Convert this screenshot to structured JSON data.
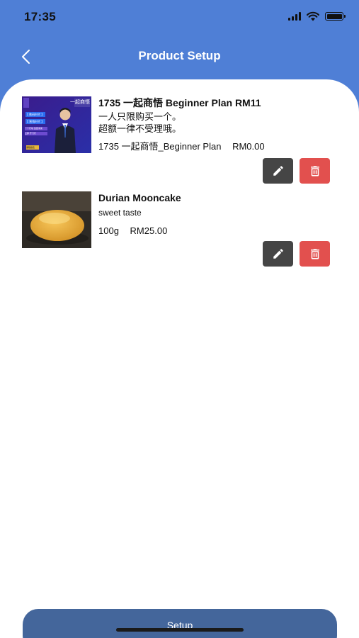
{
  "status_bar": {
    "time": "17:35"
  },
  "nav": {
    "title": "Product Setup"
  },
  "products": [
    {
      "name": "1735 一起商悟 Beginner Plan RM11",
      "description": "一人只限购买一个。\n超额一律不受理哦。",
      "variant": "1735 一起商悟_Beginner Plan",
      "price": "RM0.00",
      "thumb": {
        "brand_text": "一起商悟",
        "caption_1": "【 数码时代 】",
        "caption_2": "【 营销时代 】",
        "caption_3": "一个行动 改变未来",
        "caption_4": "立即 开门行",
        "tag": "课程报名"
      }
    },
    {
      "name": "Durian Mooncake",
      "description": "sweet taste",
      "variant": "100g",
      "price": "RM25.00"
    }
  ],
  "footer": {
    "setup_label": "Setup"
  },
  "colors": {
    "header": "#4f7fd6",
    "edit": "#454545",
    "delete": "#e2504e",
    "setup": "#44669b"
  }
}
